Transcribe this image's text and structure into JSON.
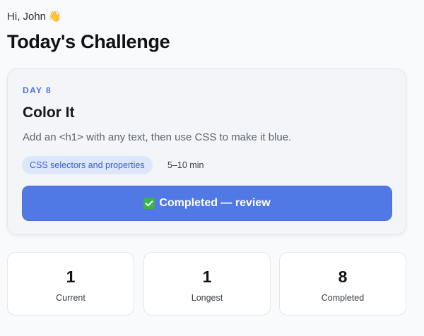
{
  "header": {
    "greeting": "Hi, John",
    "greeting_emoji": "👋",
    "title": "Today's Challenge"
  },
  "challenge": {
    "day_label": "DAY 8",
    "title": "Color It",
    "description": "Add an <h1> with any text, then use CSS to make it blue.",
    "tag": "CSS selectors and properties",
    "duration": "5–10 min",
    "button_label": "Completed — review",
    "button_icon": "check-mark-icon"
  },
  "stats": [
    {
      "value": "1",
      "label": "Current"
    },
    {
      "value": "1",
      "label": "Longest"
    },
    {
      "value": "8",
      "label": "Completed"
    }
  ],
  "colors": {
    "accent": "#5179e6",
    "day_label": "#4f72d9",
    "tag_bg": "#dde7fb",
    "check": "#3bb34a"
  }
}
